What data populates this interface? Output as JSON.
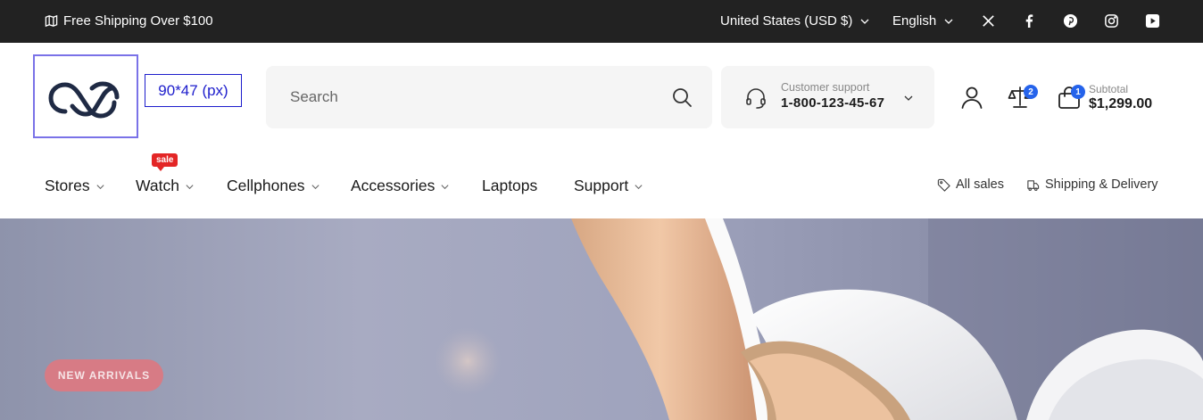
{
  "topbar": {
    "shipping_text": "Free Shipping Over $100",
    "currency": "United States (USD $)",
    "language": "English",
    "social": [
      "x-icon",
      "facebook-icon",
      "pinterest-icon",
      "instagram-icon",
      "youtube-icon"
    ]
  },
  "header": {
    "logo_dimensions_label": "90*47 (px)",
    "search": {
      "placeholder": "Search"
    },
    "support": {
      "label": "Customer support",
      "phone": "1-800-123-45-67"
    },
    "compare_count": "2",
    "cart_count": "1",
    "subtotal_label": "Subtotal",
    "subtotal_value": "$1,299.00"
  },
  "nav": {
    "items": [
      {
        "label": "Stores"
      },
      {
        "label": "Watch",
        "badge": "sale"
      },
      {
        "label": "Cellphones"
      },
      {
        "label": "Accessories"
      },
      {
        "label": "Laptops"
      },
      {
        "label": "Support"
      }
    ],
    "right": [
      {
        "label": "All sales"
      },
      {
        "label": "Shipping & Delivery"
      }
    ]
  },
  "hero": {
    "tag": "NEW ARRIVALS"
  },
  "colors": {
    "topbar_bg": "#222222",
    "accent_blue": "#2563eb",
    "sale_red": "#e32626",
    "pill": "#d77b85"
  }
}
